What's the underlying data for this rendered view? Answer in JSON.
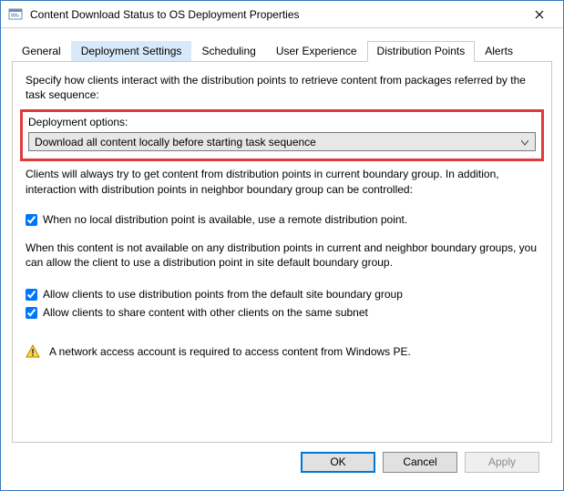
{
  "window": {
    "title": "Content Download Status to OS Deployment Properties"
  },
  "tabs": [
    {
      "label": "General"
    },
    {
      "label": "Deployment Settings"
    },
    {
      "label": "Scheduling"
    },
    {
      "label": "User Experience"
    },
    {
      "label": "Distribution Points"
    },
    {
      "label": "Alerts"
    }
  ],
  "panel": {
    "intro": "Specify how clients interact with the distribution points to retrieve content from packages referred by the task sequence:",
    "deployment_options_label": "Deployment options:",
    "deployment_options_value": "Download all content locally before starting task sequence",
    "boundary_note": "Clients will always try to get content from distribution points in current boundary group. In addition, interaction with distribution points in neighbor boundary group can be controlled:",
    "check_remote_dp": "When no local distribution point is available, use a remote distribution point.",
    "fallback_note": "When this content is not available on any distribution points in current and neighbor boundary groups, you can allow the client to use a distribution point in site default boundary group.",
    "check_default_site": "Allow clients to use distribution points from the default site boundary group",
    "check_share_subnet": "Allow clients to share content with other clients on the same subnet",
    "warning": "A network access account is required to access content from Windows PE."
  },
  "buttons": {
    "ok": "OK",
    "cancel": "Cancel",
    "apply": "Apply"
  },
  "state": {
    "active_tab_index": 4,
    "check_remote_dp": true,
    "check_default_site": true,
    "check_share_subnet": true,
    "apply_enabled": false
  },
  "colors": {
    "highlight_border": "#e03a3a",
    "accent": "#0078d7"
  }
}
